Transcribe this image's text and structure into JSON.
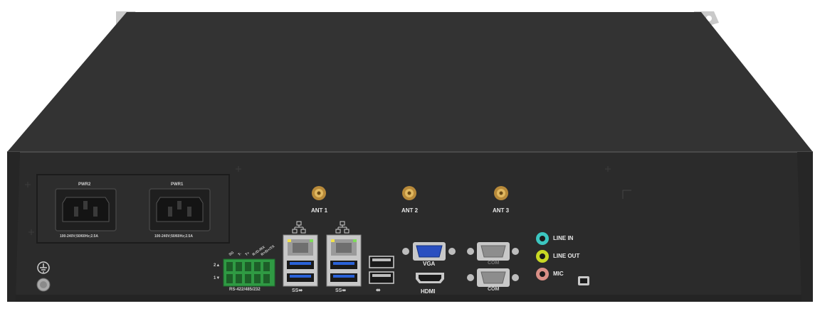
{
  "power": {
    "pwr2": {
      "label": "PWR2",
      "rating": "100-240V;50/60Hz;2.5A"
    },
    "pwr1": {
      "label": "PWR1",
      "rating": "100-240V;50/60Hz;2.5A"
    }
  },
  "antennas": [
    "ANT 1",
    "ANT 2",
    "ANT 3"
  ],
  "serial_terminal": {
    "label": "RS-422/485/232",
    "pins": [
      "SG",
      "T-",
      "T+",
      "R-/D-/RX",
      "R+/D+/TX"
    ],
    "row_labels": [
      "2▲",
      "1▼"
    ]
  },
  "usb_labels": [
    "SS⬌",
    "SS⬌",
    "⬌"
  ],
  "video": {
    "vga": "VGA",
    "hdmi": "HDMI"
  },
  "com": [
    "COM",
    "COM"
  ],
  "audio": [
    {
      "label": "LINE IN",
      "color": "#3cc6c0"
    },
    {
      "label": "LINE OUT",
      "color": "#c8d824"
    },
    {
      "label": "MIC",
      "color": "#d98f86"
    }
  ],
  "colors": {
    "chassis": "#2e2e2e",
    "usb3": "#2a62d8",
    "terminal": "#2f9a43"
  }
}
